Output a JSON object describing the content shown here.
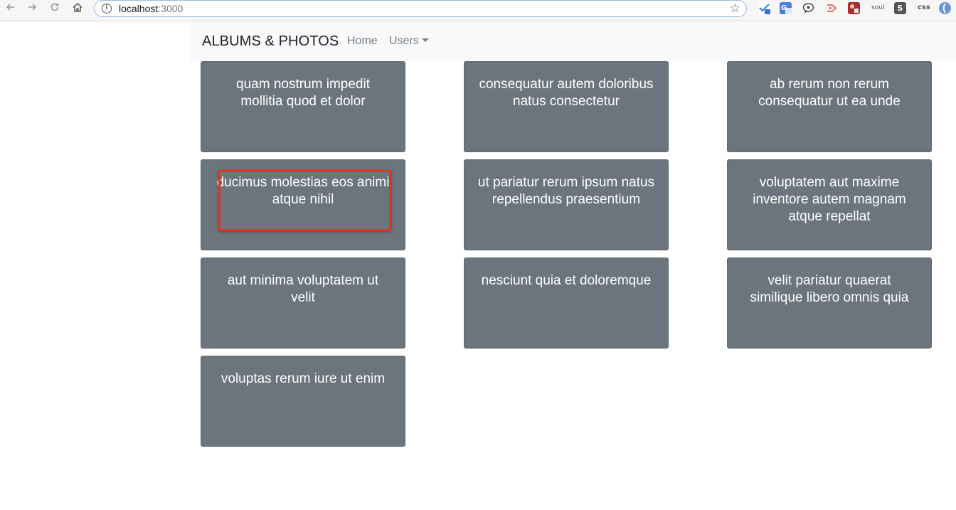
{
  "browser": {
    "url_host": "localhost",
    "url_port": ":3000",
    "extensions": [
      "ext-checkmark",
      "ext-translate",
      "ext-chat",
      "ext-play",
      "ext-photo",
      "ext-soul",
      "ext-s",
      "ext-css",
      "ext-globe"
    ],
    "ext_labels": {
      "soul": "soul",
      "s": "S",
      "css": "css"
    }
  },
  "navbar": {
    "brand": "ALBUMS & PHOTOS",
    "home": "Home",
    "users": "Users"
  },
  "albums": [
    "quam nostrum impedit mollitia quod et dolor",
    "consequatur autem doloribus natus consectetur",
    "ab rerum non rerum consequatur ut ea unde",
    "ducimus molestias eos animi atque nihil",
    "ut pariatur rerum ipsum natus repellendus praesentium",
    "voluptatem aut maxime inventore autem magnam atque repellat",
    "aut minima voluptatem ut velit",
    "nesciunt quia et doloremque",
    "velit pariatur quaerat similique libero omnis quia",
    "voluptas rerum iure ut enim"
  ],
  "colors": {
    "card": "#6c757d",
    "navbar": "#f8f9fa",
    "highlight": "#d9391f"
  }
}
